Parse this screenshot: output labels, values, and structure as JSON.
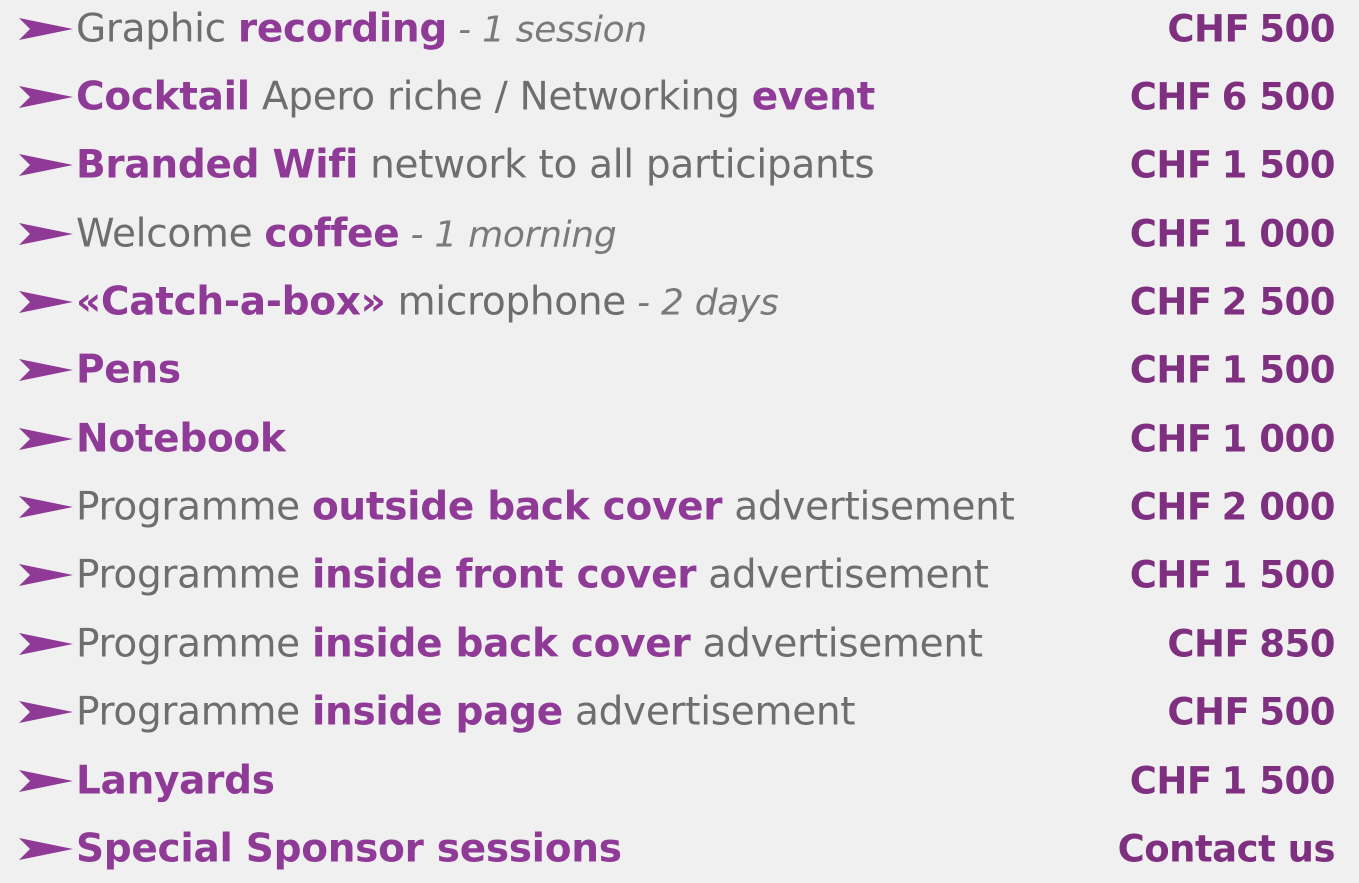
{
  "colors": {
    "background": "#f0f0f0",
    "accent": "#8e3a96",
    "price": "#7e2f7f",
    "text": "#6e6e6e"
  },
  "icons": {
    "bullet": "arrow-right-icon"
  },
  "items": [
    {
      "parts": [
        {
          "text": "Graphic ",
          "style": "plain"
        },
        {
          "text": "recording",
          "style": "hl"
        },
        {
          "text": " - 1 session",
          "style": "note"
        }
      ],
      "currency": "CHF",
      "amount": "500"
    },
    {
      "parts": [
        {
          "text": "Cocktail",
          "style": "hl"
        },
        {
          "text": " Apero riche / Networking ",
          "style": "plain"
        },
        {
          "text": "event",
          "style": "hl"
        }
      ],
      "currency": "CHF",
      "amount": "6 500"
    },
    {
      "parts": [
        {
          "text": "Branded Wifi",
          "style": "hl"
        },
        {
          "text": " network to all participants",
          "style": "plain"
        }
      ],
      "currency": "CHF",
      "amount": "1 500"
    },
    {
      "parts": [
        {
          "text": "Welcome ",
          "style": "plain"
        },
        {
          "text": "coffee",
          "style": "hl"
        },
        {
          "text": " - 1 morning",
          "style": "note"
        }
      ],
      "currency": "CHF",
      "amount": "1 000"
    },
    {
      "parts": [
        {
          "text": "«Catch-a-box»",
          "style": "hl"
        },
        {
          "text": " microphone",
          "style": "plain"
        },
        {
          "text": " - 2 days",
          "style": "note"
        }
      ],
      "currency": "CHF",
      "amount": "2 500"
    },
    {
      "parts": [
        {
          "text": "Pens",
          "style": "hl"
        }
      ],
      "currency": "CHF",
      "amount": "1 500"
    },
    {
      "parts": [
        {
          "text": "Notebook",
          "style": "hl"
        }
      ],
      "currency": "CHF",
      "amount": "1 000"
    },
    {
      "parts": [
        {
          "text": "Programme ",
          "style": "plain"
        },
        {
          "text": "outside back cover",
          "style": "hl"
        },
        {
          "text": " advertisement",
          "style": "plain"
        }
      ],
      "currency": "CHF",
      "amount": "2 000"
    },
    {
      "parts": [
        {
          "text": "Programme ",
          "style": "plain"
        },
        {
          "text": "inside front cover",
          "style": "hl"
        },
        {
          "text": " advertisement",
          "style": "plain"
        }
      ],
      "currency": "CHF",
      "amount": "1 500"
    },
    {
      "parts": [
        {
          "text": "Programme ",
          "style": "plain"
        },
        {
          "text": "inside back cover",
          "style": "hl"
        },
        {
          "text": " advertisement",
          "style": "plain"
        }
      ],
      "currency": "CHF",
      "amount": "850"
    },
    {
      "parts": [
        {
          "text": "Programme ",
          "style": "plain"
        },
        {
          "text": "inside page",
          "style": "hl"
        },
        {
          "text": " advertisement",
          "style": "plain"
        }
      ],
      "currency": "CHF",
      "amount": "500"
    },
    {
      "parts": [
        {
          "text": "Lanyards",
          "style": "hl"
        }
      ],
      "currency": "CHF",
      "amount": "1 500"
    },
    {
      "parts": [
        {
          "text": "Special Sponsor sessions",
          "style": "hl"
        }
      ],
      "currency": "",
      "amount": "Contact us"
    }
  ]
}
